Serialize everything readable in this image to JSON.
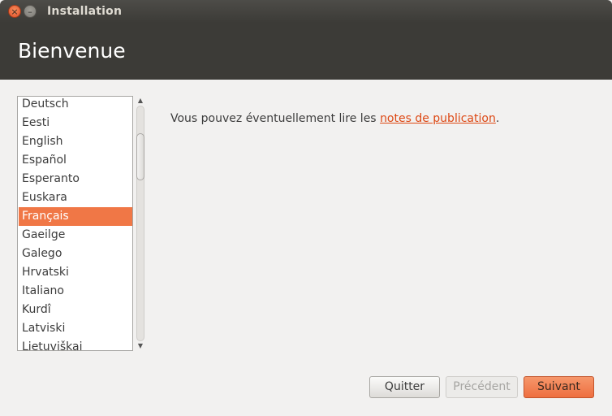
{
  "window": {
    "title": "Installation",
    "close_glyph": "×",
    "minimize_glyph": "–"
  },
  "header": {
    "title": "Bienvenue"
  },
  "languages": {
    "items": [
      "Deutsch",
      "Eesti",
      "English",
      "Español",
      "Esperanto",
      "Euskara",
      "Français",
      "Gaeilge",
      "Galego",
      "Hrvatski",
      "Italiano",
      "Kurdî",
      "Latviski",
      "Lietuviškai"
    ],
    "selected": "Français"
  },
  "scrollbar": {
    "up_glyph": "▲",
    "down_glyph": "▼"
  },
  "message": {
    "prefix": "Vous pouvez éventuellement lire les ",
    "link": "notes de publication",
    "suffix": "."
  },
  "buttons": {
    "quit": "Quitter",
    "previous": "Précédent",
    "next": "Suivant"
  },
  "colors": {
    "accent": "#f07746",
    "link": "#dd4814",
    "header_bg": "#3c3b37"
  }
}
